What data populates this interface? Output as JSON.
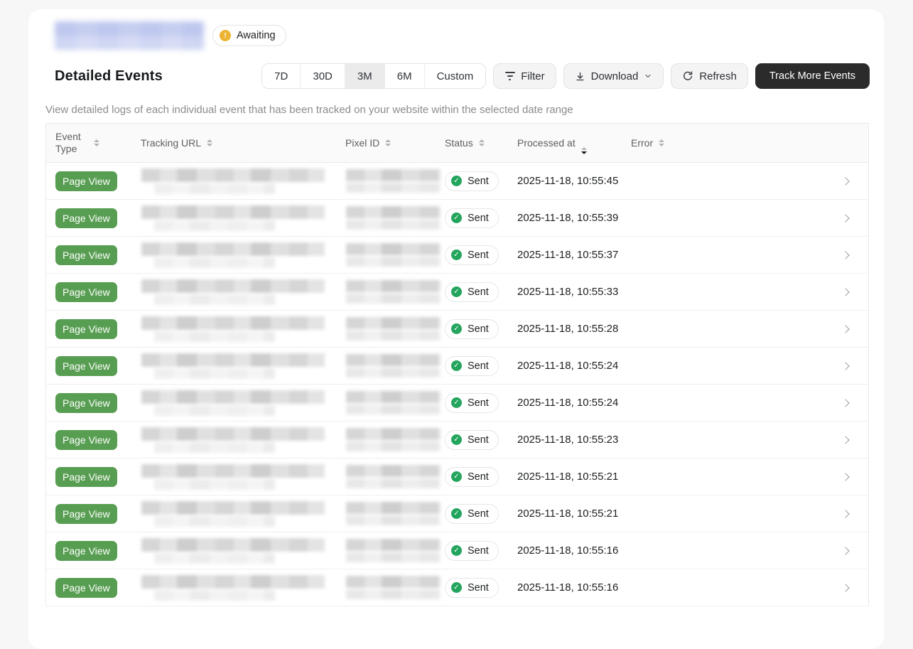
{
  "page": {
    "status_badge": "Awaiting",
    "title": "Detailed Events",
    "description": "View detailed logs of each individual event that has been tracked on your website within the selected date range"
  },
  "toolbar": {
    "date_ranges": [
      {
        "label": "7D",
        "selected": false
      },
      {
        "label": "30D",
        "selected": false
      },
      {
        "label": "3M",
        "selected": true
      },
      {
        "label": "6M",
        "selected": false
      },
      {
        "label": "Custom",
        "selected": false
      }
    ],
    "filter_label": "Filter",
    "download_label": "Download",
    "refresh_label": "Refresh",
    "track_more_label": "Track More Events"
  },
  "table": {
    "columns": [
      "Event Type",
      "Tracking URL",
      "Pixel ID",
      "Status",
      "Processed at",
      "Error"
    ],
    "sort": {
      "column": "Processed at",
      "direction": "desc"
    },
    "rows": [
      {
        "event_type": "Page View",
        "status": "Sent",
        "processed_at": "2025-11-18, 10:55:45",
        "error": ""
      },
      {
        "event_type": "Page View",
        "status": "Sent",
        "processed_at": "2025-11-18, 10:55:39",
        "error": ""
      },
      {
        "event_type": "Page View",
        "status": "Sent",
        "processed_at": "2025-11-18, 10:55:37",
        "error": ""
      },
      {
        "event_type": "Page View",
        "status": "Sent",
        "processed_at": "2025-11-18, 10:55:33",
        "error": ""
      },
      {
        "event_type": "Page View",
        "status": "Sent",
        "processed_at": "2025-11-18, 10:55:28",
        "error": ""
      },
      {
        "event_type": "Page View",
        "status": "Sent",
        "processed_at": "2025-11-18, 10:55:24",
        "error": ""
      },
      {
        "event_type": "Page View",
        "status": "Sent",
        "processed_at": "2025-11-18, 10:55:24",
        "error": ""
      },
      {
        "event_type": "Page View",
        "status": "Sent",
        "processed_at": "2025-11-18, 10:55:23",
        "error": ""
      },
      {
        "event_type": "Page View",
        "status": "Sent",
        "processed_at": "2025-11-18, 10:55:21",
        "error": ""
      },
      {
        "event_type": "Page View",
        "status": "Sent",
        "processed_at": "2025-11-18, 10:55:21",
        "error": ""
      },
      {
        "event_type": "Page View",
        "status": "Sent",
        "processed_at": "2025-11-18, 10:55:16",
        "error": ""
      },
      {
        "event_type": "Page View",
        "status": "Sent",
        "processed_at": "2025-11-18, 10:55:16",
        "error": ""
      }
    ]
  },
  "icons": {
    "warning": "warning-icon",
    "filter": "filter-icon",
    "download": "download-icon",
    "chevron_down": "chevron-down-icon",
    "refresh": "refresh-icon",
    "sort": "sort-icon",
    "check": "check-circle-icon",
    "chevron_right": "chevron-right-icon"
  },
  "colors": {
    "event_badge_green": "#589e52",
    "status_check_green": "#23a55d",
    "awaiting_amber": "#edb332",
    "dark_button": "#2b2b2c"
  }
}
